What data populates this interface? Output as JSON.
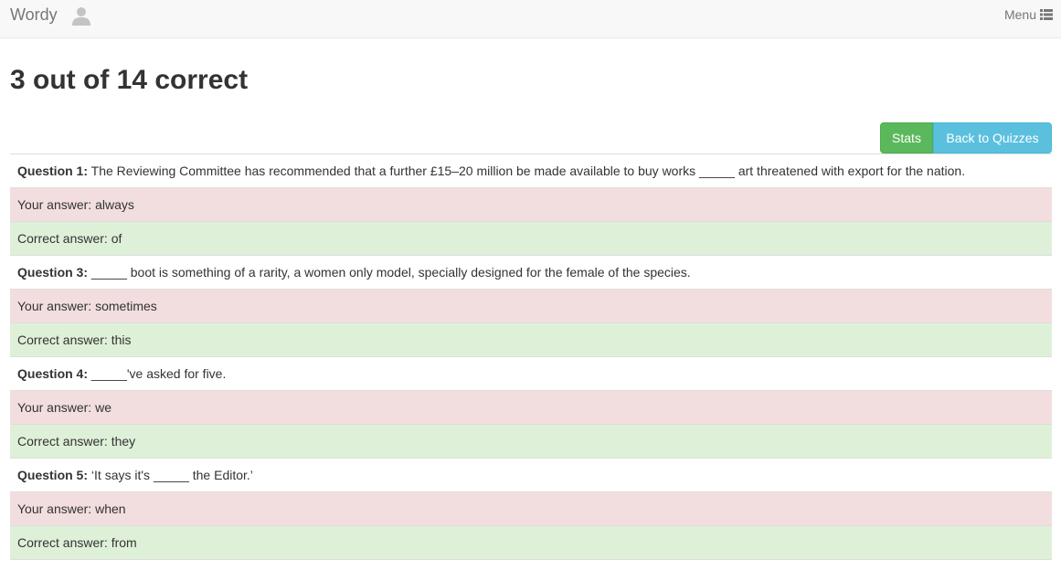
{
  "navbar": {
    "brand": "Wordy",
    "menu_label": "Menu",
    "avatar_icon": "user-icon",
    "menu_icon": "list-icon"
  },
  "page": {
    "title": "3 out of 14 correct"
  },
  "buttons": {
    "stats": "Stats",
    "back": "Back to Quizzes"
  },
  "colors": {
    "stats_button": "#5cb85c",
    "back_button": "#5bc0de",
    "wrong_row": "#f2dede",
    "correct_row": "#dff0d8"
  },
  "results": [
    {
      "label": "Question 1",
      "question": "The Reviewing Committee has recommended that a further £15–20 million be made available to buy works _____ art threatened with export for the nation.",
      "your_answer": "Your answer: always",
      "correct_answer": "Correct answer: of"
    },
    {
      "label": "Question 3",
      "question": "_____ boot is something of a rarity, a women only model, specially designed for the female of the species.",
      "your_answer": "Your answer: sometimes",
      "correct_answer": "Correct answer: this"
    },
    {
      "label": "Question 4",
      "question": "_____'ve asked for five.",
      "your_answer": "Your answer: we",
      "correct_answer": "Correct answer: they"
    },
    {
      "label": "Question 5",
      "question": "‘It says it's _____ the Editor.’",
      "your_answer": "Your answer: when",
      "correct_answer": "Correct answer: from"
    }
  ]
}
